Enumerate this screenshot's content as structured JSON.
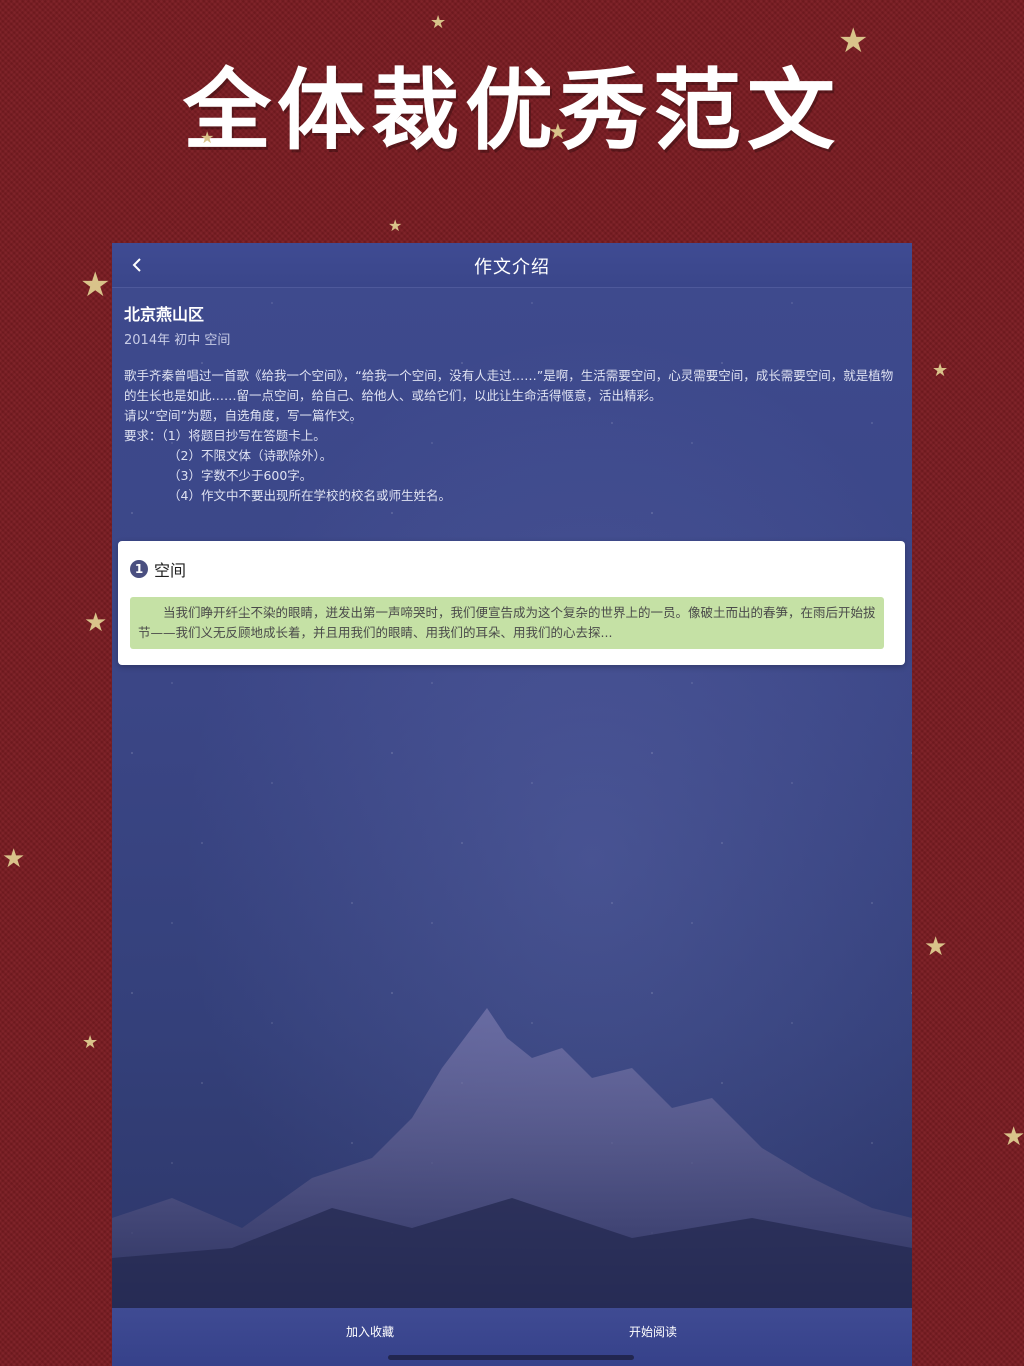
{
  "promo": {
    "title": "全体裁优秀范文"
  },
  "colors": {
    "background": "#7a1c22",
    "star": "#d9c38a",
    "device_bg": "#3b4686",
    "excerpt_bg": "#c5e1a5"
  },
  "app": {
    "nav": {
      "back_icon": "chevron-left-icon",
      "title": "作文介绍"
    },
    "intro": {
      "district": "北京燕山区",
      "meta": "2014年 初中 空间",
      "prompt": "歌手齐秦曾唱过一首歌《给我一个空间》，“给我一个空间，没有人走过……”是啊，生活需要空间，心灵需要空间，成长需要空间，就是植物的生长也是如此……留一点空间，给自己、给他人、或给它们，以此让生命活得惬意，活出精彩。",
      "instruction": "请以“空间”为题，自选角度，写一篇作文。",
      "requirements_label": "要求：",
      "requirements": [
        "（1）将题目抄写在答题卡上。",
        "（2）不限文体（诗歌除外）。",
        "（3）字数不少于600字。",
        "（4）作文中不要出现所在学校的校名或师生姓名。"
      ]
    },
    "essay": {
      "index": "1",
      "title": "空间",
      "excerpt": "当我们睁开纤尘不染的眼睛，迸发出第一声啼哭时，我们便宣告成为这个复杂的世界上的一员。像破土而出的春笋，在雨后开始拔节——我们义无反顾地成长着，并且用我们的眼睛、用我们的耳朵、用我们的心去探..."
    },
    "bottom": {
      "favorite_label": "加入收藏",
      "read_label": "开始阅读"
    }
  }
}
